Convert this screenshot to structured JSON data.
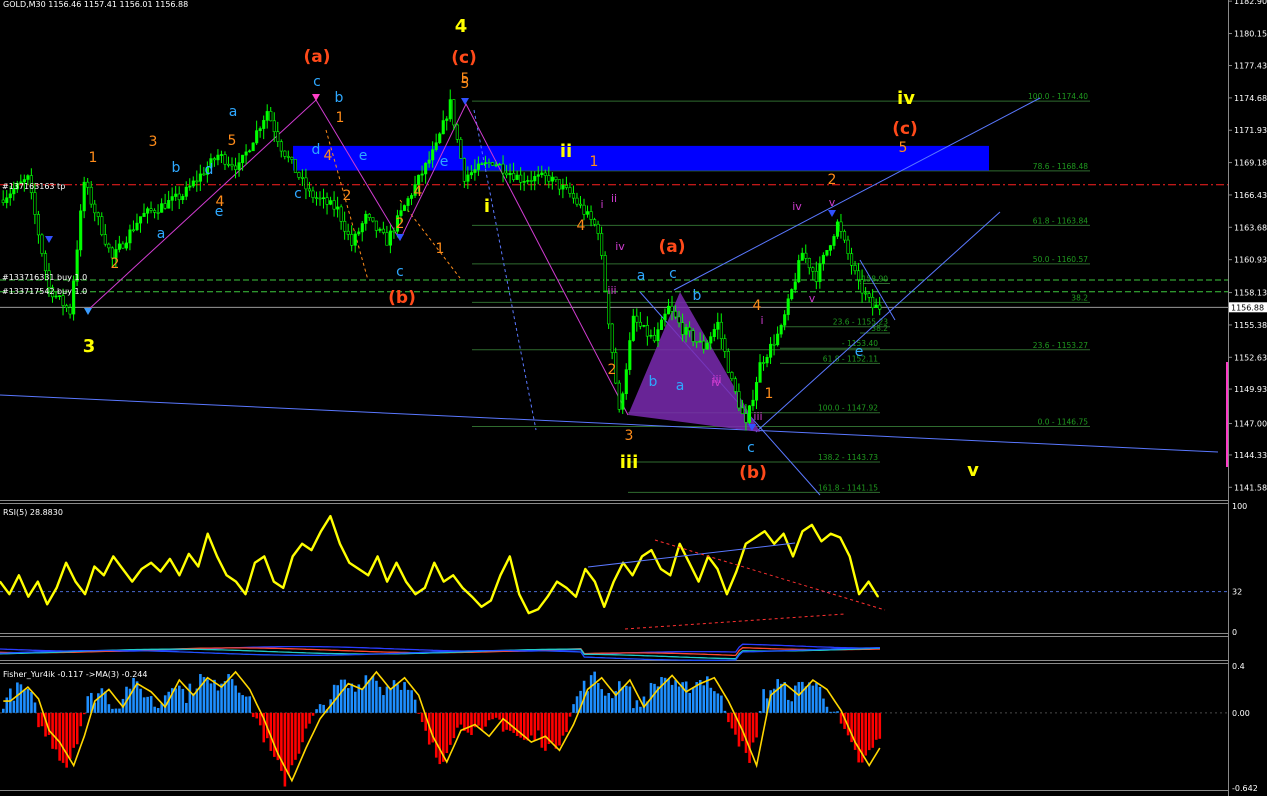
{
  "window": {
    "title": "GOLD,M30  1156.46 1157.41 1156.01 1156.88"
  },
  "colors": {
    "background": "#000000",
    "bull_candle": "#00ff00",
    "bear_candle": "#00ff00",
    "rsi_line": "#ffff00",
    "fisher_pos": "#1e8fff",
    "fisher_neg": "#ff0000",
    "fisher_signal": "#ffd700",
    "wave_orange": "#ff8c1a",
    "wave_red": "#ff4a1a",
    "wave_yellow": "#ffff00",
    "wave_cyan": "#2ea8ff",
    "wave_magenta": "#d03cd0",
    "fib_line": "#2f6b2f",
    "zone_blue": "#0000ff",
    "trend_blue": "#5a78ff"
  },
  "chart_data": [
    {
      "type": "candlestick",
      "symbol_label": "GOLD,M30  1156.46 1157.41 1156.01 1156.88",
      "ylim": [
        1140.5,
        1183.0
      ],
      "y_ticks": [
        "1182.90",
        "1180.15",
        "1177.43",
        "1174.68",
        "1171.93",
        "1169.18",
        "1166.43",
        "1163.68",
        "1160.93",
        "1158.13",
        "1155.38",
        "1152.63",
        "1149.93",
        "1147.00",
        "1144.33",
        "1141.58"
      ],
      "current_price_label": "1156.88",
      "waypoints": [
        [
          0,
          1166.0
        ],
        [
          8,
          1167.8
        ],
        [
          14,
          1158.5
        ],
        [
          20,
          1156.5
        ],
        [
          24,
          1167.5
        ],
        [
          32,
          1161.0
        ],
        [
          40,
          1164.6
        ],
        [
          52,
          1166.4
        ],
        [
          62,
          1169.8
        ],
        [
          68,
          1168.8
        ],
        [
          76,
          1173.6
        ],
        [
          80,
          1170.5
        ],
        [
          88,
          1166.5
        ],
        [
          96,
          1165.2
        ],
        [
          100,
          1162.2
        ],
        [
          104,
          1164.5
        ],
        [
          110,
          1162.5
        ],
        [
          118,
          1167.2
        ],
        [
          124,
          1170.5
        ],
        [
          128,
          1174.2
        ],
        [
          132,
          1168.0
        ],
        [
          140,
          1169.3
        ],
        [
          148,
          1167.8
        ],
        [
          156,
          1167.9
        ],
        [
          162,
          1166.5
        ],
        [
          170,
          1163.5
        ],
        [
          172,
          1158.4
        ],
        [
          176,
          1147.9
        ],
        [
          180,
          1155.8
        ],
        [
          186,
          1154.0
        ],
        [
          190,
          1156.8
        ],
        [
          194,
          1155.0
        ],
        [
          200,
          1153.5
        ],
        [
          204,
          1155.5
        ],
        [
          208,
          1150.5
        ],
        [
          212,
          1146.8
        ],
        [
          216,
          1152.0
        ],
        [
          222,
          1155.0
        ],
        [
          228,
          1161.5
        ],
        [
          232,
          1159.5
        ],
        [
          238,
          1164.0
        ],
        [
          244,
          1158.8
        ],
        [
          248,
          1156.9
        ]
      ],
      "trade_labels": [
        "#137163163 tp",
        "#133716331 buy 1.0",
        "#133717542 buy 1.0"
      ],
      "fib_levels": [
        {
          "label": "100.0 - 1174.40",
          "value": 1174.4
        },
        {
          "label": "78.6 - 1168.48",
          "value": 1168.48
        },
        {
          "label": "61.8 - 1163.84",
          "value": 1163.84
        },
        {
          "label": "50.0 - 1160.57",
          "value": 1160.57
        },
        {
          "label": "38.2",
          "value": 1157.3
        },
        {
          "label": "23.6 - 1153.27",
          "value": 1153.27
        },
        {
          "label": "0.0 - 1146.75",
          "value": 1146.75
        },
        {
          "label": "100.0 - 1147.92",
          "value": 1147.92
        },
        {
          "label": "138.2 - 1143.73",
          "value": 1143.73
        },
        {
          "label": "161.8 - 1141.15",
          "value": 1141.15
        },
        {
          "label": "61.8 - 1152.11",
          "value": 1152.11
        },
        {
          "label": "- 1153.40",
          "value": 1153.4
        },
        {
          "label": "1158.90",
          "value": 1158.9
        },
        {
          "label": "38.2",
          "value": 1154.7
        },
        {
          "label": "23.6 - 1155.23",
          "value": 1155.23
        }
      ],
      "wave_labels": [
        {
          "text": "3",
          "color": "#ffff00",
          "size": 18
        },
        {
          "text": "4",
          "color": "#ffff00",
          "size": 18
        },
        {
          "text": "(a)",
          "color": "#ff4a1a",
          "size": 17
        },
        {
          "text": "(c)",
          "color": "#ff4a1a",
          "size": 17
        },
        {
          "text": "(b)",
          "color": "#ff4a1a",
          "size": 17
        },
        {
          "text": "(a)",
          "color": "#ff4a1a",
          "size": 17
        },
        {
          "text": "(b)",
          "color": "#ff4a1a",
          "size": 17
        },
        {
          "text": "(c)",
          "color": "#ff4a1a",
          "size": 17
        },
        {
          "text": "iv",
          "color": "#ffff00",
          "size": 18
        },
        {
          "text": "v",
          "color": "#ffff00",
          "size": 18
        },
        {
          "text": "iii",
          "color": "#ffff00",
          "size": 18
        },
        {
          "text": "ii",
          "color": "#ffff00",
          "size": 18
        },
        {
          "text": "i",
          "color": "#ffff00",
          "size": 18
        },
        {
          "text": "5",
          "color": "#ff8c1a",
          "size": 14
        },
        {
          "text": "3",
          "color": "#ff8c1a",
          "size": 14
        },
        {
          "text": "2",
          "color": "#ff8c1a",
          "size": 14
        },
        {
          "text": "1",
          "color": "#ff8c1a",
          "size": 14
        },
        {
          "text": "4",
          "color": "#ff8c1a",
          "size": 14
        },
        {
          "text": "a",
          "color": "#2ea8ff",
          "size": 14
        },
        {
          "text": "b",
          "color": "#2ea8ff",
          "size": 14
        },
        {
          "text": "c",
          "color": "#2ea8ff",
          "size": 14
        },
        {
          "text": "d",
          "color": "#2ea8ff",
          "size": 14
        },
        {
          "text": "e",
          "color": "#2ea8ff",
          "size": 14
        },
        {
          "text": "ii",
          "color": "#d03cd0",
          "size": 11
        },
        {
          "text": "iii",
          "color": "#d03cd0",
          "size": 11
        },
        {
          "text": "iv",
          "color": "#d03cd0",
          "size": 11
        },
        {
          "text": "v",
          "color": "#d03cd0",
          "size": 11
        },
        {
          "text": "i",
          "color": "#d03cd0",
          "size": 11
        }
      ]
    },
    {
      "type": "line",
      "title": "RSI(5) 28.8830",
      "ylim": [
        0,
        100
      ],
      "y_ticks": [
        "100",
        "32",
        "0"
      ],
      "level": 32,
      "values": [
        40,
        30,
        45,
        28,
        40,
        22,
        35,
        55,
        40,
        30,
        52,
        45,
        60,
        50,
        40,
        50,
        55,
        48,
        58,
        45,
        62,
        52,
        78,
        60,
        45,
        40,
        30,
        55,
        60,
        40,
        35,
        60,
        70,
        65,
        80,
        92,
        70,
        55,
        50,
        45,
        60,
        40,
        55,
        40,
        30,
        35,
        55,
        40,
        45,
        35,
        28,
        20,
        25,
        45,
        60,
        30,
        15,
        18,
        28,
        40,
        35,
        28,
        50,
        40,
        20,
        40,
        55,
        45,
        60,
        65,
        50,
        45,
        70,
        55,
        40,
        60,
        50,
        30,
        48,
        70,
        75,
        80,
        70,
        78,
        60,
        80,
        85,
        72,
        78,
        75,
        60,
        30,
        40,
        28
      ]
    },
    {
      "type": "line",
      "title": "",
      "note": "multi-line oscillator band",
      "series_count": 4
    },
    {
      "type": "bar",
      "title": "Fisher_Yur4ik -0.117  ->MA(3) -0.244",
      "ylim": [
        -0.642,
        0.4
      ],
      "y_ticks": [
        "0.4",
        "0.00",
        "-0.642"
      ],
      "waypoints": [
        [
          0,
          0.1
        ],
        [
          5,
          0.22
        ],
        [
          8,
          0.12
        ],
        [
          11,
          -0.15
        ],
        [
          14,
          -0.25
        ],
        [
          18,
          -0.45
        ],
        [
          21,
          -0.2
        ],
        [
          24,
          0.1
        ],
        [
          28,
          0.2
        ],
        [
          32,
          0.05
        ],
        [
          36,
          0.25
        ],
        [
          40,
          0.18
        ],
        [
          44,
          0.05
        ],
        [
          48,
          0.28
        ],
        [
          52,
          0.15
        ],
        [
          56,
          0.3
        ],
        [
          60,
          0.22
        ],
        [
          64,
          0.35
        ],
        [
          68,
          0.2
        ],
        [
          72,
          -0.05
        ],
        [
          76,
          -0.35
        ],
        [
          80,
          -0.58
        ],
        [
          84,
          -0.3
        ],
        [
          88,
          -0.05
        ],
        [
          92,
          0.1
        ],
        [
          96,
          0.25
        ],
        [
          100,
          0.2
        ],
        [
          104,
          0.35
        ],
        [
          108,
          0.2
        ],
        [
          112,
          0.3
        ],
        [
          116,
          0.15
        ],
        [
          120,
          -0.2
        ],
        [
          124,
          -0.42
        ],
        [
          128,
          -0.15
        ],
        [
          132,
          -0.1
        ],
        [
          136,
          -0.2
        ],
        [
          140,
          -0.05
        ],
        [
          144,
          -0.15
        ],
        [
          148,
          -0.25
        ],
        [
          152,
          -0.2
        ],
        [
          156,
          -0.32
        ],
        [
          160,
          -0.1
        ],
        [
          164,
          0.2
        ],
        [
          168,
          0.3
        ],
        [
          172,
          0.15
        ],
        [
          176,
          0.28
        ],
        [
          180,
          0.05
        ],
        [
          184,
          0.2
        ],
        [
          188,
          0.32
        ],
        [
          192,
          0.18
        ],
        [
          196,
          0.25
        ],
        [
          200,
          0.3
        ],
        [
          204,
          0.1
        ],
        [
          208,
          -0.15
        ],
        [
          212,
          -0.45
        ],
        [
          216,
          0.15
        ],
        [
          220,
          0.25
        ],
        [
          224,
          0.15
        ],
        [
          228,
          0.28
        ],
        [
          232,
          0.2
        ],
        [
          236,
          0.02
        ],
        [
          240,
          -0.25
        ],
        [
          244,
          -0.45
        ],
        [
          248,
          -0.25
        ]
      ]
    }
  ]
}
